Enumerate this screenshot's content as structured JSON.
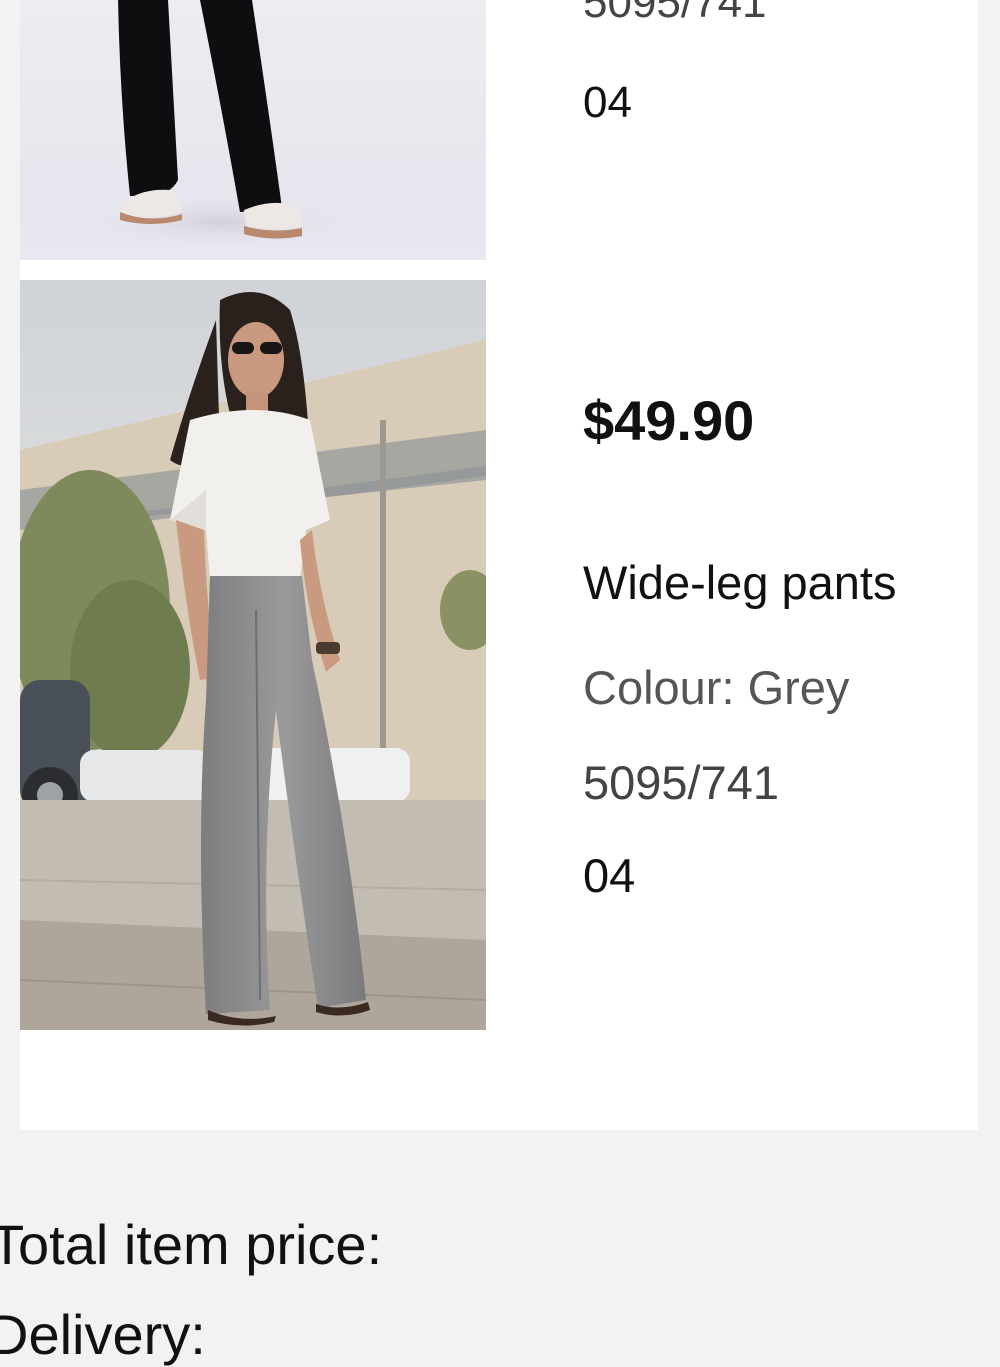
{
  "items": [
    {
      "code": "5095/741",
      "size": "04",
      "image_alt": "Black wide-leg pants worn with sneakers"
    },
    {
      "price": "$49.90",
      "name": "Wide-leg pants",
      "colour": "Colour: Grey",
      "code": "5095/741",
      "size": "04",
      "image_alt": "Model wearing grey wide-leg pants and white top"
    }
  ],
  "summary": {
    "total_label": "Total item price:",
    "delivery_label": "Delivery:"
  },
  "colors": {
    "background": "#f2f2f2",
    "panel": "#ffffff",
    "secondary_text": "#555555"
  }
}
